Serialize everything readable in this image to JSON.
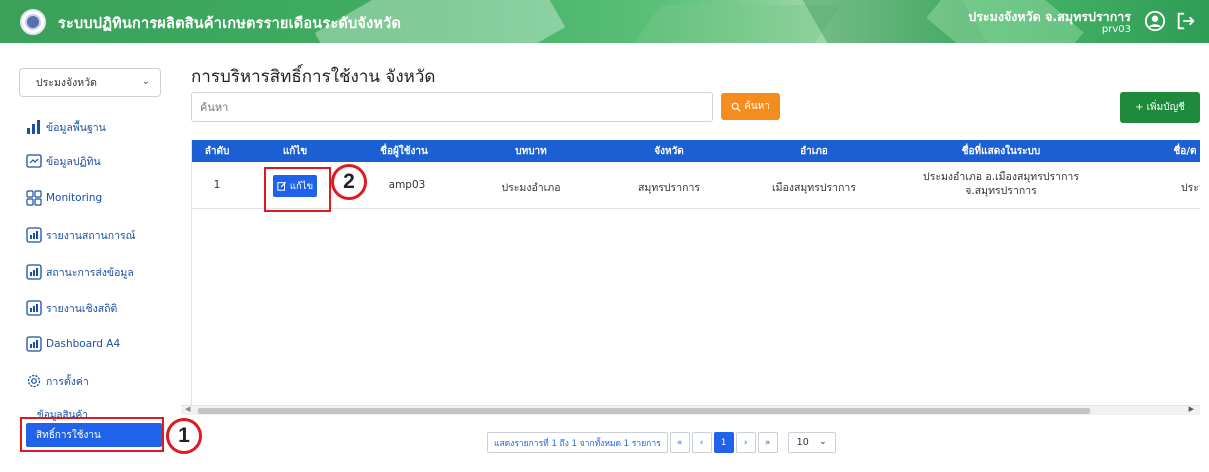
{
  "header": {
    "title": "ระบบปฏิทินการผลิตสินค้าเกษตรรายเดือนระดับจังหวัด",
    "user_name": "ประมงจังหวัด จ.สมุทรปราการ",
    "user_code": "prv03"
  },
  "sidebar": {
    "role_select": "ประมงจังหวัด",
    "items": [
      {
        "label": "ข้อมูลพื้นฐาน",
        "icon": "bar-chart-icon"
      },
      {
        "label": "ข้อมูลปฏิทิน",
        "icon": "calendar-chart-icon"
      },
      {
        "label": "Monitoring",
        "icon": "grid-icon"
      },
      {
        "label": "รายงานสถานการณ์",
        "icon": "report-icon"
      },
      {
        "label": "สถานะการส่งข้อมูล",
        "icon": "report-icon"
      },
      {
        "label": "รายงานเชิงสถิติ",
        "icon": "report-icon"
      },
      {
        "label": "Dashboard A4",
        "icon": "report-icon"
      },
      {
        "label": "การตั้งค่า",
        "icon": "gear-icon"
      }
    ],
    "sub_item": "ข้อมูลสินค้า",
    "active_item": "สิทธิ์การใช้งาน"
  },
  "main": {
    "title": "การบริหารสิทธิ์การใช้งาน จังหวัด",
    "search_placeholder": "ค้นหา",
    "search_button": "ค้นหา",
    "add_button": "+ เพิ่มบัญชี",
    "columns": [
      "ลำดับ",
      "แก้ไข",
      "ชื่อผู้ใช้งาน",
      "บทบาท",
      "จังหวัด",
      "อำเภอ",
      "ชื่อที่แสดงในระบบ",
      "ชื่อ/ต"
    ],
    "rows": [
      {
        "index": "1",
        "edit_label": "แก้ไข",
        "username": "amp03",
        "role": "ประมงอำเภอ",
        "province": "สมุทรปราการ",
        "district": "เมืองสมุทรปราการ",
        "display_name_line1": "ประมงอำเภอ อ.เมืองสมุทรปราการ",
        "display_name_line2": "จ.สมุทรปราการ",
        "name_partial": "ประมง"
      }
    ]
  },
  "pagination": {
    "info": "แสดงรายการที่ 1 ถึง 1 จากทั้งหมด 1 รายการ",
    "first": "«",
    "prev": "‹",
    "current_page": "1",
    "next": "›",
    "last": "»",
    "page_size": "10"
  },
  "annotations": {
    "step1": "1",
    "step2": "2"
  },
  "colors": {
    "header_green": "#3fae62",
    "primary_blue": "#1e63e9",
    "search_orange": "#f58c1e",
    "add_green": "#1f8a3c",
    "annotation_red": "#e0191f"
  }
}
